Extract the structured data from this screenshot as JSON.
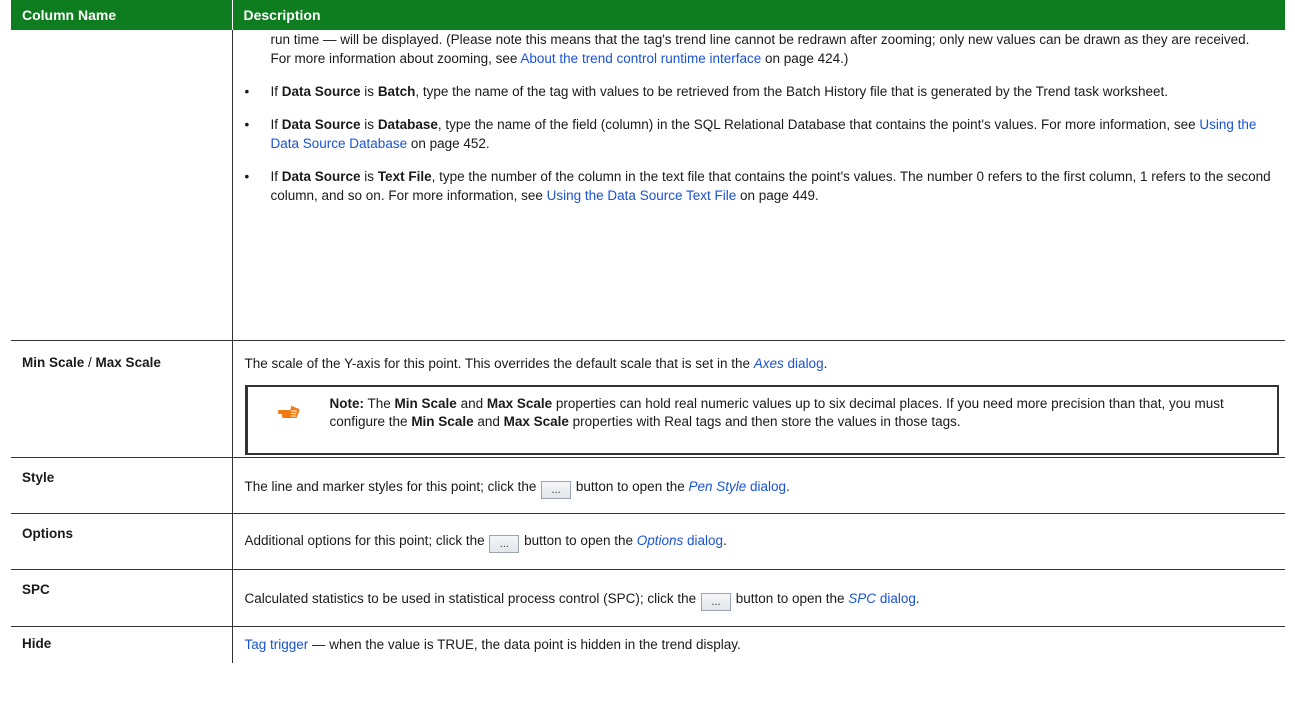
{
  "header": {
    "col_name": "Column Name",
    "col_desc": "Description"
  },
  "continued": {
    "p1_a": "run time — will be displayed. (Please note this means that the tag's trend line cannot be redrawn after zooming; only new values can be drawn as they are received. For more information about zooming, see ",
    "p1_link": "About the trend control runtime interface",
    "p1_b": " on page 424.)",
    "b1_a": "If ",
    "b1_b1": "Data Source",
    "b1_c": " is ",
    "b1_d": "Batch",
    "b1_e": ", type the name of the tag with values to be retrieved from the Batch History file that is generated by the Trend task worksheet.",
    "b2_a": "If ",
    "b2_b": "Data Source",
    "b2_c": " is ",
    "b2_d": "Database",
    "b2_e": ", type the name of the field (column) in the SQL Relational Database that contains the point's values. For more information, see ",
    "b2_link": "Using the Data Source Database",
    "b2_f": " on page 452.",
    "b3_a": "If ",
    "b3_b": "Data Source",
    "b3_c": " is ",
    "b3_d": "Text File",
    "b3_e": ", type the number of the column in the text file that contains the point's values. The number 0 refers to the first column, 1 refers to the second column, and so on. For more information, see ",
    "b3_link": "Using the Data Source Text File",
    "b3_f": " on page 449.",
    "bullet_char": "•"
  },
  "scale_row": {
    "name_a": "Min Scale",
    "name_sep": " / ",
    "name_b": "Max Scale",
    "desc_a": "The scale of the Y-axis for this point. This overrides the default scale that is set in the ",
    "desc_link_italic": "Axes",
    "desc_link_rest": " dialog",
    "desc_b": ".",
    "note_label": "Note:",
    "note_a": " The ",
    "note_b": "Min Scale",
    "note_c": " and ",
    "note_d": "Max Scale",
    "note_e": " properties can hold real numeric values up to six decimal places. If you need more precision than that, you must configure the ",
    "note_f": "Min Scale",
    "note_g": " and ",
    "note_h": "Max Scale",
    "note_i": " properties with Real tags and then store the values in those tags.",
    "note_icon": "pointing-hand-icon"
  },
  "style_row": {
    "name": "Style",
    "desc_a": "The line and marker styles for this point; click the ",
    "btn": "...",
    "desc_b": " button to open the ",
    "link_italic": "Pen Style",
    "link_rest": " dialog",
    "desc_c": "."
  },
  "options_row": {
    "name": "Options",
    "desc_a": "Additional options for this point; click the ",
    "btn": "...",
    "desc_b": " button to open the ",
    "link_italic": "Options",
    "link_rest": " dialog",
    "desc_c": "."
  },
  "spc_row": {
    "name": "SPC",
    "desc_a": "Calculated statistics to be used in statistical process control (SPC); click the ",
    "btn": "...",
    "desc_b": " button to open the ",
    "link_italic": "SPC",
    "link_rest": " dialog",
    "desc_c": "."
  },
  "hide_row": {
    "name": "Hide",
    "link": "Tag trigger",
    "desc": " — when the value is TRUE, the data point is hidden in the trend display."
  },
  "colors": {
    "header_bg": "#0e7d1f",
    "link": "#1a52d6",
    "note_icon": "#f07a14"
  }
}
